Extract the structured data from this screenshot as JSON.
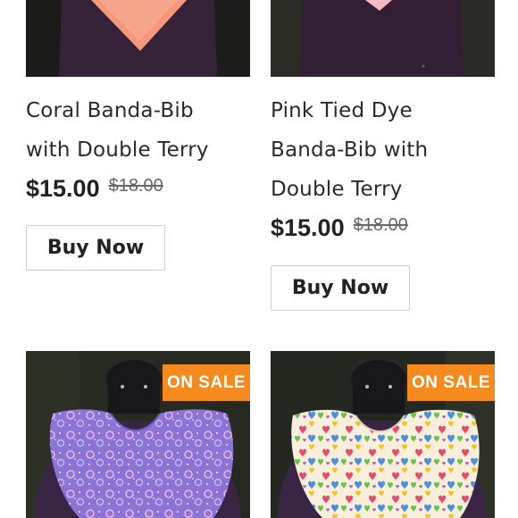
{
  "products": [
    {
      "title_line_1": "Coral Banda-Bib",
      "title_line_2": "with Double Terry",
      "price": "$15.00",
      "compare_price": "$18.00",
      "button_label": "Buy Now",
      "bib_color": "#f4977a"
    },
    {
      "title_line_1": "Pink Tied Dye",
      "title_line_2": "Banda-Bib with",
      "title_line_3": "Double Terry",
      "price": "$15.00",
      "compare_price": "$18.00",
      "button_label": "Buy Now",
      "bib_color": "#f5b7c4"
    },
    {
      "badge": "ON SALE",
      "bib_color": "#8b74d6"
    },
    {
      "badge": "ON SALE",
      "bib_color": "#f7efdc"
    }
  ],
  "colors": {
    "badge_background": "#f58a1f",
    "text": "#222222",
    "strikethrough": "#666666",
    "button_border": "#cfcfcf"
  }
}
